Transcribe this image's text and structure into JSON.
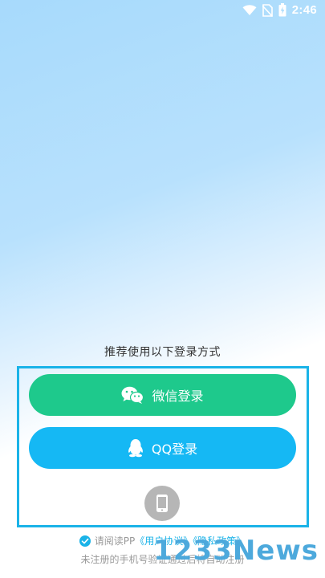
{
  "status_bar": {
    "time": "2:46",
    "icons": [
      "wifi-icon",
      "no-sim-icon",
      "battery-charging-icon"
    ]
  },
  "login": {
    "recommend_title": "推荐使用以下登录方式",
    "wechat": {
      "label": "微信登录",
      "icon": "wechat-icon",
      "color": "#1ec98c"
    },
    "qq": {
      "label": "QQ登录",
      "icon": "qq-icon",
      "color": "#15b8f4"
    },
    "phone": {
      "icon": "mobile-phone-icon"
    },
    "highlight_color": "#1ab3e8"
  },
  "agreement": {
    "prefix": "请阅读PP",
    "user_agreement": "《用户协议》",
    "privacy_policy": "《隐私政策》",
    "note": "未注册的手机号验证通过后将自动注册"
  },
  "watermark": "1233News"
}
